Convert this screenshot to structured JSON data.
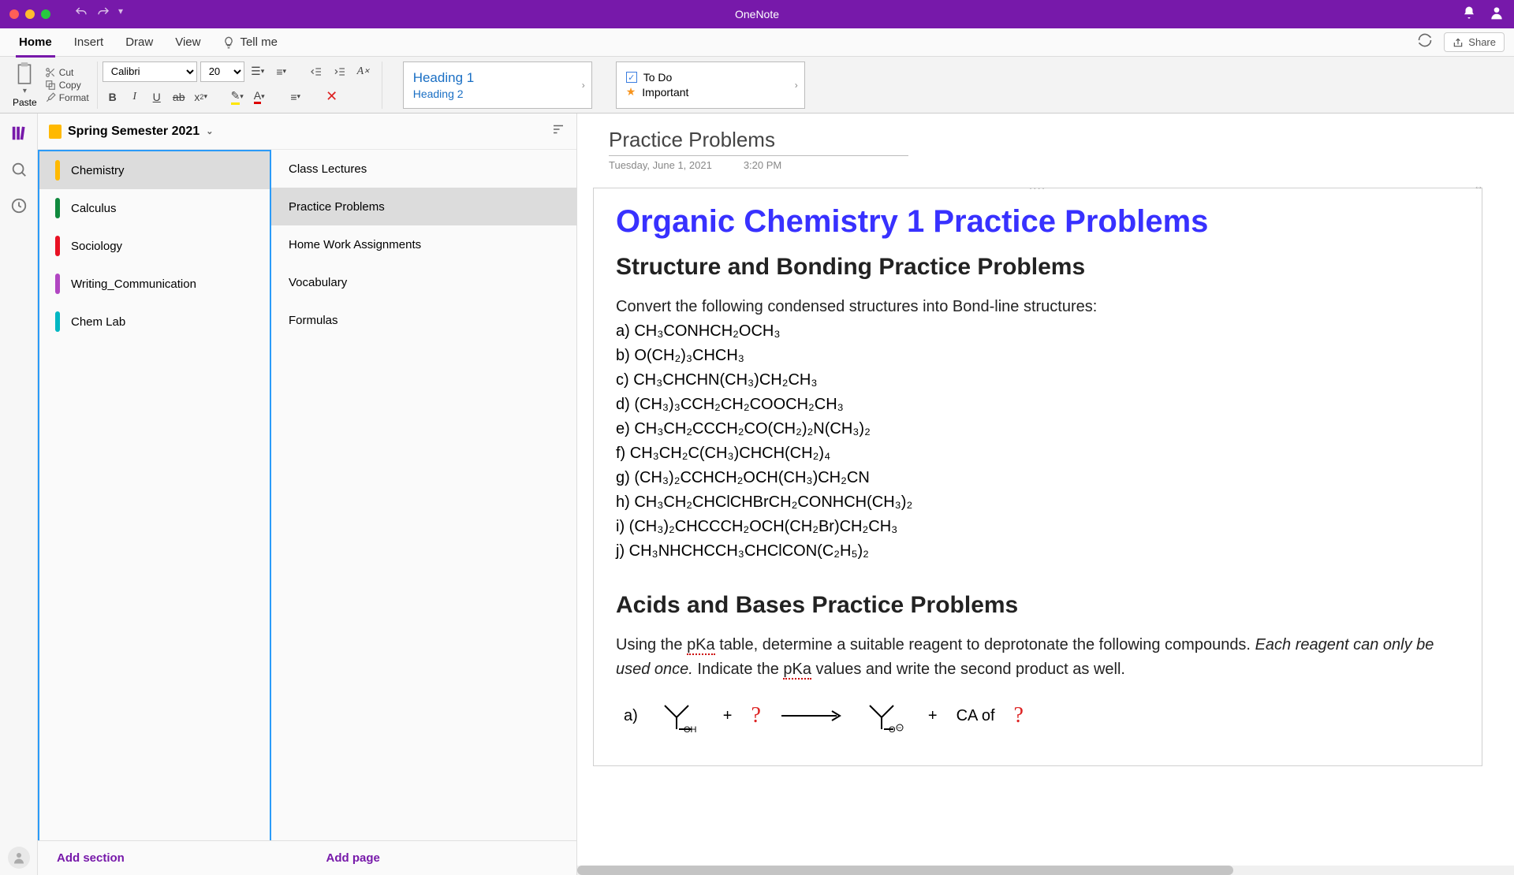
{
  "window": {
    "title": "OneNote"
  },
  "tabs": {
    "home": "Home",
    "insert": "Insert",
    "draw": "Draw",
    "view": "View",
    "tellme": "Tell me"
  },
  "share_label": "Share",
  "clipboard": {
    "paste": "Paste",
    "cut": "Cut",
    "copy": "Copy",
    "format": "Format"
  },
  "font": {
    "name": "Calibri",
    "size": "20"
  },
  "styles": {
    "heading1": "Heading 1",
    "heading2": "Heading 2"
  },
  "tags": {
    "todo": "To Do",
    "important": "Important"
  },
  "notebook": {
    "title": "Spring Semester 2021",
    "sections": [
      {
        "label": "Chemistry",
        "color": "#ffb900",
        "sel": true
      },
      {
        "label": "Calculus",
        "color": "#10893e"
      },
      {
        "label": "Sociology",
        "color": "#e81123"
      },
      {
        "label": "Writing_Communication",
        "color": "#b146c2"
      },
      {
        "label": "Chem Lab",
        "color": "#00b7c3"
      }
    ],
    "pages": [
      {
        "label": "Class Lectures"
      },
      {
        "label": "Practice Problems",
        "sel": true
      },
      {
        "label": "Home Work Assignments"
      },
      {
        "label": "Vocabulary"
      },
      {
        "label": "Formulas"
      }
    ],
    "add_section": "Add section",
    "add_page": "Add page"
  },
  "page": {
    "title": "Practice Problems",
    "date": "Tuesday, June 1, 2021",
    "time": "3:20 PM",
    "h1": "Organic Chemistry 1 Practice Problems",
    "sec1_title": "Structure and Bonding Practice Problems",
    "sec1_intro": "Convert the following condensed structures into Bond-line structures:",
    "sec1_items": [
      "a) CH₃CONHCH₂OCH₃",
      "b) O(CH₂)₃CHCH₃",
      "c) CH₃CHCHN(CH₃)CH₂CH₃",
      "d) (CH₃)₃CCH₂CH₂COOCH₂CH₃",
      "e) CH₃CH₂CCCH₂CO(CH₂)₂N(CH₃)₂",
      "f) CH₃CH₂C(CH₃)CHCH(CH₂)₄",
      "g) (CH₃)₂CCHCH₂OCH(CH₃)CH₂CN",
      "h) CH₃CH₂CHClCHBrCH₂CONHCH(CH₃)₂",
      "i) (CH₃)₂CHCCCH₂OCH(CH₂Br)CH₂CH₃",
      "j) CH₃NHCHCCH₃CHClCON(C₂H₅)₂"
    ],
    "sec2_title": "Acids and Bases Practice Problems",
    "sec2_p1a": "Using the ",
    "sec2_p1_pka": "pKa",
    "sec2_p1b": " table, determine a suitable reagent to deprotonate the following compounds. ",
    "sec2_p1_italic": "Each reagent can only be used once.",
    "sec2_p1c": " Indicate the ",
    "sec2_p1d": " values and write the second product as well.",
    "reaction_caof": "CA of"
  }
}
